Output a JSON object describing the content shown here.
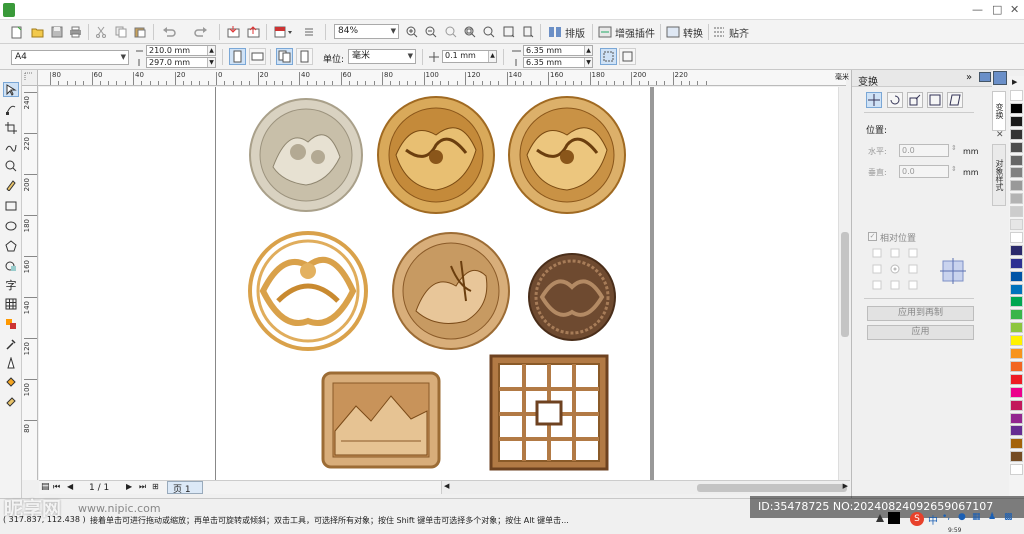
{
  "window": {
    "min_label": "—",
    "max_label": "□",
    "close_label": "✕"
  },
  "toolbar": {
    "zoom_value": "84%",
    "layout_label": "排版",
    "plugins_label": "增强插件",
    "convert_label": "转换",
    "snap_label": "贴齐"
  },
  "propertybar": {
    "page_size": "A4",
    "width": "210.0 mm",
    "height": "297.0 mm",
    "units_label": "单位:",
    "units_value": "毫米",
    "nudge": "0.1 mm",
    "dup_x": "6.35 mm",
    "dup_y": "6.35 mm"
  },
  "ruler": {
    "h_labels": [
      "80",
      "60",
      "40",
      "20",
      "0",
      "20",
      "40",
      "60",
      "80",
      "100",
      "120",
      "140",
      "160",
      "180",
      "200",
      "220"
    ],
    "h_unit": "毫米",
    "v_labels": [
      "240",
      "220",
      "200",
      "180",
      "160",
      "140",
      "120",
      "100",
      "80"
    ]
  },
  "pagenav": {
    "page_count": "1 / 1",
    "page_tab": "页 1"
  },
  "docker": {
    "title": "变换",
    "position_label": "位置:",
    "horizontal_label": "水平:",
    "horizontal_value": "0.0",
    "vertical_label": "垂直:",
    "vertical_value": "0.0",
    "unit": "mm",
    "relative_label": "相对位置",
    "apply_dup_label": "应用到再制",
    "apply_label": "应用"
  },
  "sidetabs": {
    "transform": "变换",
    "objstyle": "对象样式"
  },
  "palette_colors": [
    "#ffffff",
    "#000000",
    "#1a1a1a",
    "#333333",
    "#4d4d4d",
    "#666666",
    "#808080",
    "#999999",
    "#b3b3b3",
    "#cccccc",
    "#e6e6e6",
    "#ffffff",
    "#2b2a6b",
    "#2e3192",
    "#0054a6",
    "#0072bc",
    "#00a651",
    "#39b54a",
    "#8dc63f",
    "#fff200",
    "#f7941d",
    "#f26522",
    "#ed1c24",
    "#ec008c",
    "#c2185b",
    "#92278f",
    "#662d91",
    "#a3620a",
    "#754c24",
    "#ffffff"
  ],
  "status": {
    "coords": "( 317.837, 112.438 )",
    "hint": "接着单击可进行拖动或缩放；再单击可旋转或倾斜；双击工具，可选择所有对象；按住 Shift 键单击可选择多个对象；按住 Alt 键单击..."
  },
  "watermark": {
    "left": "昵享网",
    "left_sub": "www.nipic.com",
    "right": "ID:35478725 NO:20240824092659067107"
  },
  "taskbar": {
    "ime": "中",
    "time_partial": "9:59"
  }
}
